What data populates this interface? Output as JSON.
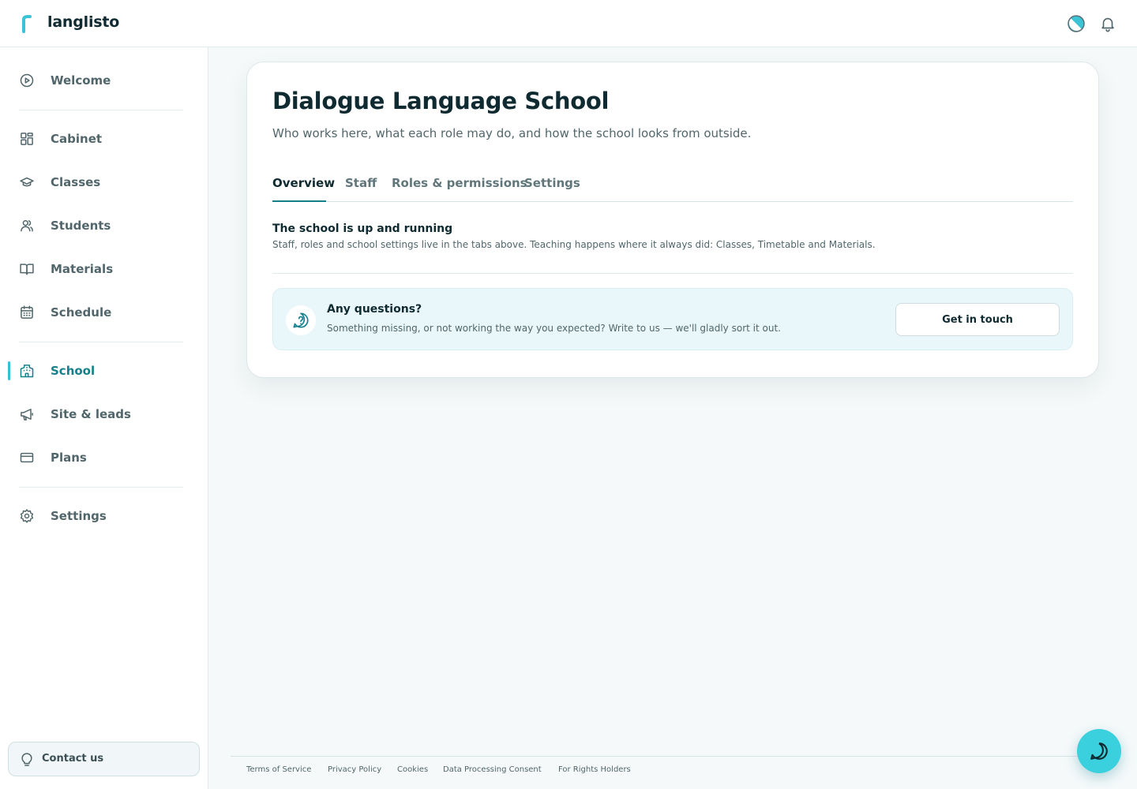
{
  "header": {
    "brand": "langlisto",
    "logo_icon": "langlisto-logo-icon",
    "theme_icon": "theme-toggle-icon",
    "notification_icon": "bell-icon",
    "accent_color": "#2fc4d4"
  },
  "sidebar": {
    "items": [
      {
        "label": "Welcome",
        "icon": "play-circle-icon"
      },
      {
        "label": "Cabinet",
        "icon": "dashboard-grid-icon"
      },
      {
        "label": "Classes",
        "icon": "graduation-cap-icon"
      },
      {
        "label": "Students",
        "icon": "users-icon"
      },
      {
        "label": "Materials",
        "icon": "book-open-icon"
      },
      {
        "label": "Schedule",
        "icon": "calendar-icon"
      },
      {
        "label": "School",
        "icon": "school-building-icon",
        "active": true
      },
      {
        "label": "Site & leads",
        "icon": "megaphone-icon"
      },
      {
        "label": "Plans",
        "icon": "credit-card-icon"
      },
      {
        "label": "Settings",
        "icon": "gear-icon"
      }
    ],
    "contact": {
      "label": "Contact us",
      "icon": "lightbulb-icon"
    }
  },
  "main": {
    "title": "Dialogue Language School",
    "subtitle": "Who works here, what each role may do, and how the school looks from outside.",
    "tabs": [
      {
        "label": "Overview",
        "active": true
      },
      {
        "label": "Staff"
      },
      {
        "label": "Roles & permissions"
      },
      {
        "label": "Settings"
      }
    ],
    "status": {
      "title": "The school is up and running",
      "text": "Staff, roles and school settings live in the tabs above. Teaching happens where it always did: Classes, Timetable and Materials."
    },
    "help": {
      "icon": "question-chat-icon",
      "title": "Any questions?",
      "text": "Something missing, or not working the way you expected? Write to us — we'll gladly sort it out.",
      "button_label": "Get in touch"
    }
  },
  "footer": {
    "links": [
      "Terms of Service",
      "Privacy Policy",
      "Cookies",
      "Data Processing Consent",
      "For Rights Holders"
    ]
  },
  "chat": {
    "icon": "chat-bubble-icon"
  }
}
